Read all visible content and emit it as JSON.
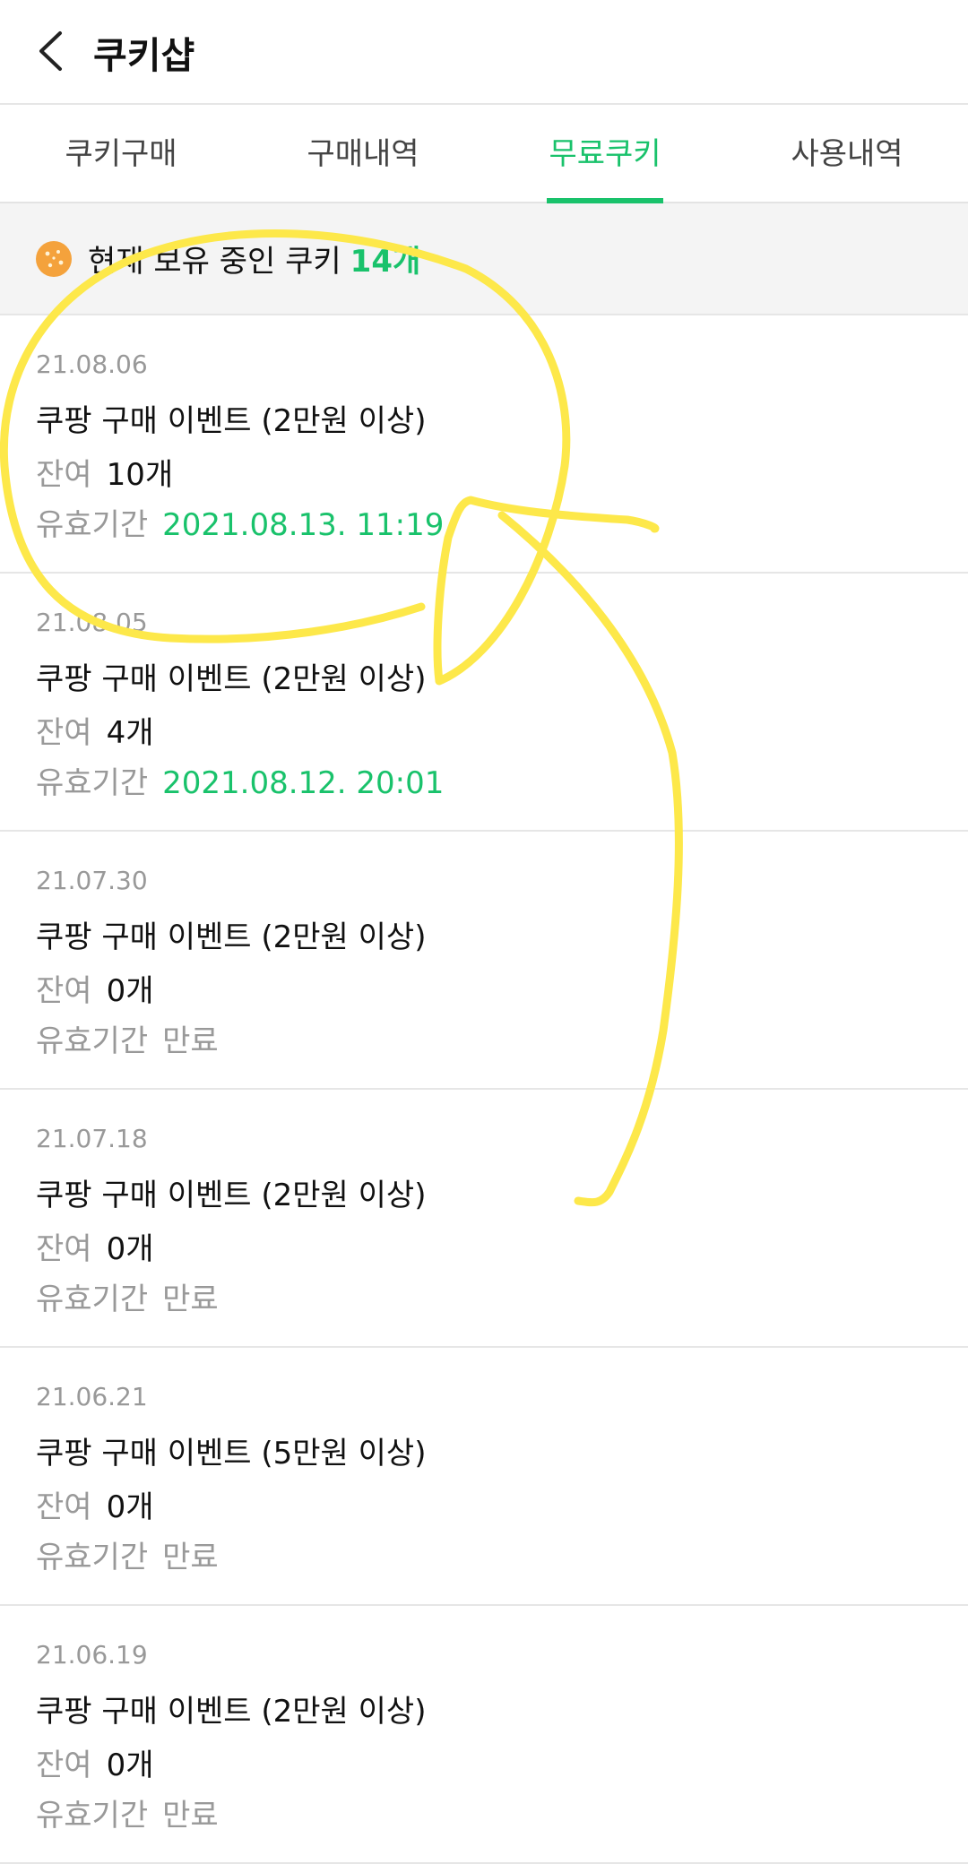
{
  "header": {
    "title": "쿠키샵",
    "back_icon": "chevron-left-icon"
  },
  "tabs": [
    {
      "label": "쿠키구매",
      "active": false
    },
    {
      "label": "구매내역",
      "active": false
    },
    {
      "label": "무료쿠키",
      "active": true
    },
    {
      "label": "사용내역",
      "active": false
    }
  ],
  "summary": {
    "icon": "cookie-icon",
    "text": "현재 보유 중인 쿠키",
    "count": "14개"
  },
  "labels": {
    "remaining": "잔여",
    "expiry": "유효기간"
  },
  "items": [
    {
      "date": "21.08.06",
      "title": "쿠팡 구매 이벤트 (2만원 이상)",
      "remaining": "10개",
      "expiry": "2021.08.13. 11:19",
      "expired": false
    },
    {
      "date": "21.08.05",
      "title": "쿠팡 구매 이벤트 (2만원 이상)",
      "remaining": "4개",
      "expiry": "2021.08.12. 20:01",
      "expired": false
    },
    {
      "date": "21.07.30",
      "title": "쿠팡 구매 이벤트 (2만원 이상)",
      "remaining": "0개",
      "expiry": "만료",
      "expired": true
    },
    {
      "date": "21.07.18",
      "title": "쿠팡 구매 이벤트 (2만원 이상)",
      "remaining": "0개",
      "expiry": "만료",
      "expired": true
    },
    {
      "date": "21.06.21",
      "title": "쿠팡 구매 이벤트 (5만원 이상)",
      "remaining": "0개",
      "expiry": "만료",
      "expired": true
    },
    {
      "date": "21.06.19",
      "title": "쿠팡 구매 이벤트 (2만원 이상)",
      "remaining": "0개",
      "expiry": "만료",
      "expired": true
    }
  ],
  "colors": {
    "accent": "#19c26b",
    "annotation": "#fde84a"
  }
}
